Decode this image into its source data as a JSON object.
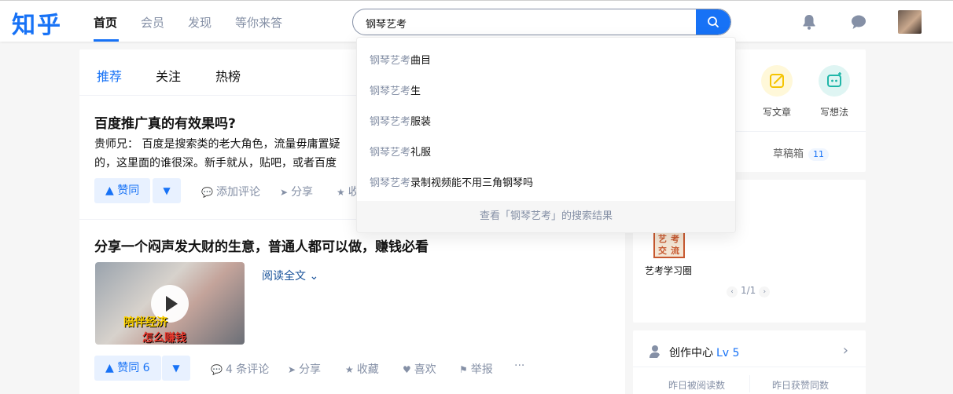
{
  "header": {
    "logo": "知乎",
    "nav": [
      "首页",
      "会员",
      "发现",
      "等你来答"
    ],
    "search_value": "钢琴艺考"
  },
  "dropdown": {
    "query": "钢琴艺考",
    "suggestions": [
      {
        "prefix": "钢琴艺考",
        "suffix": "曲目"
      },
      {
        "prefix": "钢琴艺考",
        "suffix": "生"
      },
      {
        "prefix": "钢琴艺考",
        "suffix": "服装"
      },
      {
        "prefix": "钢琴艺考",
        "suffix": "礼服"
      },
      {
        "prefix": "钢琴艺考",
        "suffix": "录制视频能不用三角钢琴吗"
      }
    ],
    "footer": "查看「钢琴艺考」的搜索结果"
  },
  "tabs": [
    "推荐",
    "关注",
    "热榜"
  ],
  "feed": [
    {
      "title": "百度推广真的有效果吗?",
      "excerpt_line1": "贵师兄： 百度是搜索类的老大角色，流量毋庸置疑",
      "excerpt_line2": "的，这里面的谁很深。新手就从，贴吧，或者百度",
      "vote": "赞同",
      "actions": [
        "添加评论",
        "分享",
        "收藏"
      ]
    },
    {
      "title": "分享一个闷声发大财的生意，普通人都可以做，赚钱必看",
      "video_caption1": "陪伴经济",
      "video_caption2": "怎么赚钱",
      "read_more": "阅读全文",
      "vote": "赞同 6",
      "actions": [
        "4 条评论",
        "分享",
        "收藏",
        "喜欢",
        "举报"
      ],
      "more": "···"
    }
  ],
  "create": {
    "items": [
      "写文章",
      "写想法"
    ],
    "draft_label": "草稿箱",
    "draft_count": "11"
  },
  "circle": {
    "image_text": [
      "艺",
      "考",
      "交",
      "流"
    ],
    "name": "艺考学习圈",
    "pager": "1/1"
  },
  "creator_center": {
    "title": "创作中心",
    "level": "Lv 5",
    "stats": [
      "昨日被阅读数",
      "昨日获赞同数"
    ]
  },
  "colors": {
    "brand": "#1772f6",
    "muted": "#8590a6"
  }
}
